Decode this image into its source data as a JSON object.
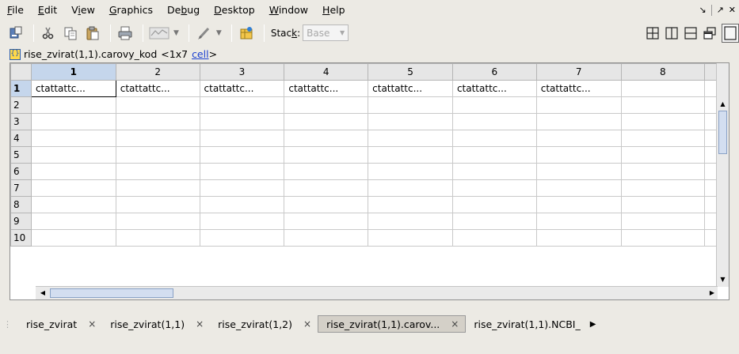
{
  "menu": {
    "items": [
      {
        "mnemonic": "F",
        "rest": "ile"
      },
      {
        "mnemonic": "E",
        "rest": "dit"
      },
      {
        "pre": "V",
        "mnemonic": "i",
        "rest": "ew"
      },
      {
        "mnemonic": "G",
        "rest": "raphics"
      },
      {
        "pre": "De",
        "mnemonic": "b",
        "rest": "ug"
      },
      {
        "mnemonic": "D",
        "rest": "esktop"
      },
      {
        "mnemonic": "W",
        "rest": "indow"
      },
      {
        "mnemonic": "H",
        "rest": "elp"
      }
    ]
  },
  "window_controls": {
    "undock": "↘",
    "maximize": "↗",
    "close": "✕"
  },
  "toolbar": {
    "stack_label_pre": "Stac",
    "stack_label_mn": "k",
    "stack_label_post": ":",
    "stack_value": "Base"
  },
  "variable": {
    "name": "rise_zvirat(1,1).carovy_kod",
    "size": "<1x7",
    "class_link": "cell",
    "close": ">"
  },
  "grid": {
    "columns": [
      "1",
      "2",
      "3",
      "4",
      "5",
      "6",
      "7",
      "8"
    ],
    "rows": [
      "1",
      "2",
      "3",
      "4",
      "5",
      "6",
      "7",
      "8",
      "9",
      "10"
    ],
    "row1_cells": [
      "ctattattc...",
      "ctattattc...",
      "ctattattc...",
      "ctattattc...",
      "ctattattc...",
      "ctattattc...",
      "ctattattc...",
      ""
    ]
  },
  "tabs": [
    {
      "label": "rise_zvirat",
      "close": "×",
      "active": false
    },
    {
      "label": "rise_zvirat(1,1)",
      "close": "×",
      "active": false
    },
    {
      "label": "rise_zvirat(1,2)",
      "close": "×",
      "active": false
    },
    {
      "label": "rise_zvirat(1,1).carov...",
      "close": "×",
      "active": true
    },
    {
      "label": "rise_zvirat(1,1).NCBI_",
      "close": "",
      "active": false
    }
  ],
  "icons": [
    "undock-icon",
    "cut-icon",
    "copy-icon",
    "paste-icon",
    "print-icon",
    "plot-icon",
    "brush-icon",
    "new-variable-icon",
    "tile-icon",
    "split-vertical-icon",
    "split-horizontal-icon",
    "float-icon",
    "dock-icon",
    "struct-icon"
  ]
}
